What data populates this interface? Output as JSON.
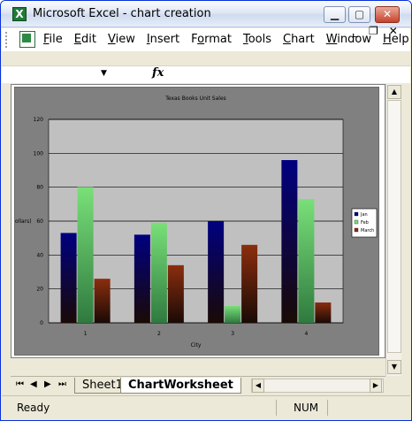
{
  "window": {
    "title": "Microsoft Excel - chart creation"
  },
  "titlebar_buttons": {
    "minimize": "▁",
    "maximize": "▢",
    "close": "✕"
  },
  "menu": [
    {
      "pre": "",
      "ul": "F",
      "post": "ile"
    },
    {
      "pre": "",
      "ul": "E",
      "post": "dit"
    },
    {
      "pre": "",
      "ul": "V",
      "post": "iew"
    },
    {
      "pre": "",
      "ul": "I",
      "post": "nsert"
    },
    {
      "pre": "F",
      "ul": "o",
      "post": "rmat"
    },
    {
      "pre": "",
      "ul": "T",
      "post": "ools"
    },
    {
      "pre": "",
      "ul": "C",
      "post": "hart"
    },
    {
      "pre": "",
      "ul": "W",
      "post": "indow"
    },
    {
      "pre": "",
      "ul": "H",
      "post": "elp"
    }
  ],
  "doc_controls": {
    "minimize": "_",
    "restore": "❐",
    "close": "✕"
  },
  "formula_bar": {
    "name_box": "",
    "fx": "fx"
  },
  "sheet_tabs": {
    "nav": [
      "⏮",
      "◀",
      "▶",
      "⏭"
    ],
    "tabs": [
      {
        "label": "Sheet1",
        "active": false
      },
      {
        "label": "ChartWorksheet",
        "active": true
      }
    ]
  },
  "status": {
    "left": "Ready",
    "num": "NUM"
  },
  "colors": {
    "jan": "#000080",
    "feb": "#79e079",
    "march": "#8b2e0f",
    "plot_bg": "#c0c0c0",
    "chart_bg": "#808080"
  },
  "chart_data": {
    "type": "bar",
    "title": "Texas Books Unit Sales",
    "xlabel": "City",
    "ylabel": "ollars)",
    "categories": [
      "1",
      "2",
      "3",
      "4"
    ],
    "series": [
      {
        "name": "Jan",
        "values": [
          53,
          52,
          60,
          96
        ]
      },
      {
        "name": "Feb",
        "values": [
          80,
          59,
          10,
          73
        ]
      },
      {
        "name": "March",
        "values": [
          26,
          34,
          46,
          12
        ]
      }
    ],
    "legend_labels": [
      "Jan",
      "Feb",
      "March"
    ],
    "ylim": [
      0,
      120
    ],
    "yticks": [
      0,
      20,
      40,
      60,
      80,
      100,
      120
    ],
    "grid": true,
    "legend_position": "right"
  }
}
